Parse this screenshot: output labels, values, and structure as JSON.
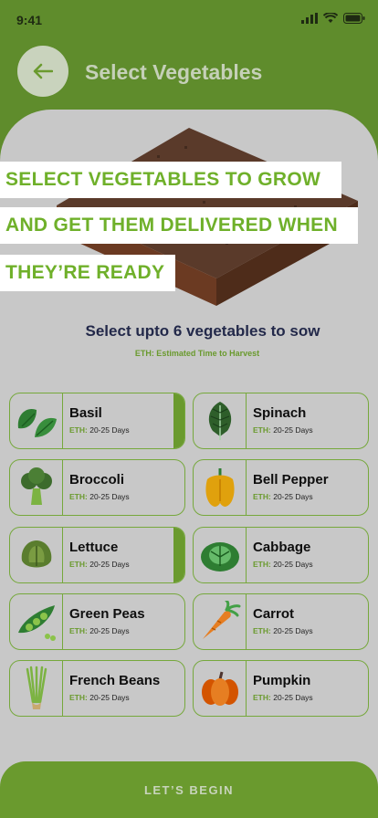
{
  "status_bar": {
    "time": "9:41"
  },
  "header": {
    "title": "Select Vegetables"
  },
  "banner": {
    "line1": "SELECT VEGETABLES TO GROW",
    "line2": "AND GET THEM DELIVERED WHEN",
    "line3": "THEY’RE READY"
  },
  "section": {
    "heading": "Select upto 6 vegetables to sow",
    "eth_note": "ETH: Estimated Time to Harvest"
  },
  "eth_label": "ETH:",
  "vegetables": [
    {
      "name": "Basil",
      "eth": "20-25 Days",
      "selected": true,
      "icon": "basil-icon"
    },
    {
      "name": "Spinach",
      "eth": "20-25 Days",
      "selected": false,
      "icon": "spinach-icon"
    },
    {
      "name": "Broccoli",
      "eth": "20-25 Days",
      "selected": false,
      "icon": "broccoli-icon"
    },
    {
      "name": "Bell Pepper",
      "eth": "20-25 Days",
      "selected": false,
      "icon": "bell-pepper-icon"
    },
    {
      "name": "Lettuce",
      "eth": "20-25 Days",
      "selected": true,
      "icon": "lettuce-icon"
    },
    {
      "name": "Cabbage",
      "eth": "20-25 Days",
      "selected": false,
      "icon": "cabbage-icon"
    },
    {
      "name": "Green Peas",
      "eth": "20-25 Days",
      "selected": false,
      "icon": "green-peas-icon"
    },
    {
      "name": "Carrot",
      "eth": "20-25 Days",
      "selected": false,
      "icon": "carrot-icon"
    },
    {
      "name": "French Beans",
      "eth": "20-25 Days",
      "selected": false,
      "icon": "french-beans-icon"
    },
    {
      "name": "Pumpkin",
      "eth": "20-25 Days",
      "selected": false,
      "icon": "pumpkin-icon"
    }
  ],
  "cta": {
    "label": "LET’S BEGIN"
  },
  "colors": {
    "accent": "#6a9a2e",
    "banner_text": "#6fb02a",
    "heading": "#23294a"
  }
}
